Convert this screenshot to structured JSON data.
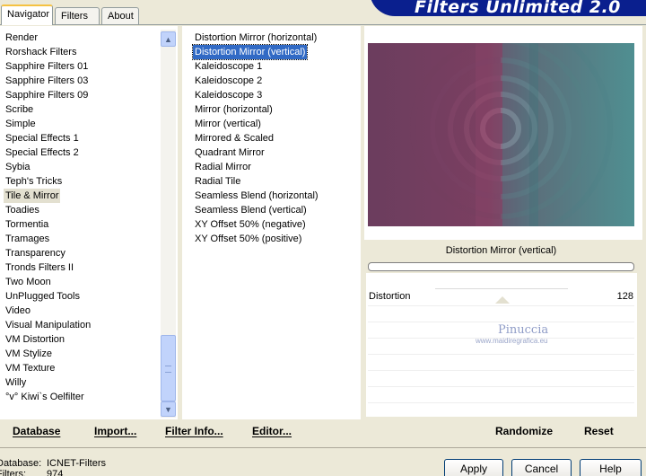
{
  "tabs": [
    "Navigator",
    "Filters",
    "About"
  ],
  "app_title": "Filters Unlimited 2.0",
  "categories": [
    "Render",
    "Rorshack Filters",
    "Sapphire Filters 01",
    "Sapphire Filters 03",
    "Sapphire Filters 09",
    "Scribe",
    "Simple",
    "Special Effects 1",
    "Special Effects 2",
    "Sybia",
    "Teph's Tricks",
    "Tile & Mirror",
    "Toadies",
    "Tormentia",
    "Tramages",
    "Transparency",
    "Tronds Filters II",
    "Two Moon",
    "UnPlugged Tools",
    "Video",
    "Visual Manipulation",
    "VM Distortion",
    "VM Stylize",
    "VM Texture",
    "Willy",
    "°v° Kiwi`s Oelfilter"
  ],
  "selected_category": "Tile & Mirror",
  "filters": [
    "Distortion Mirror (horizontal)",
    "Distortion Mirror (vertical)",
    "Kaleidoscope 1",
    "Kaleidoscope 2",
    "Kaleidoscope 3",
    "Mirror (horizontal)",
    "Mirror (vertical)",
    "Mirrored & Scaled",
    "Quadrant Mirror",
    "Radial Mirror",
    "Radial Tile",
    "Seamless Blend (horizontal)",
    "Seamless Blend (vertical)",
    "XY Offset 50% (negative)",
    "XY Offset 50% (positive)"
  ],
  "selected_filter": "Distortion Mirror (vertical)",
  "preview": {
    "filter_name": "Distortion Mirror (vertical)",
    "param_label": "Distortion",
    "param_value": "128",
    "watermark_name": "Pinuccia",
    "watermark_url": "www.maidiregrafica.eu"
  },
  "buttons": {
    "database": "Database",
    "import": "Import...",
    "filter_info": "Filter Info...",
    "editor": "Editor...",
    "randomize": "Randomize",
    "reset": "Reset",
    "apply": "Apply",
    "cancel": "Cancel",
    "help": "Help"
  },
  "status": {
    "database_label": "Database:",
    "database_value": "ICNET-Filters",
    "filters_label": "Filters:",
    "filters_value": "974"
  },
  "colors": {
    "selection_blue": "#316ac5",
    "banner_blue": "#0a1f8e",
    "preview_left": "#7b3f61",
    "preview_right": "#4f8f91"
  }
}
